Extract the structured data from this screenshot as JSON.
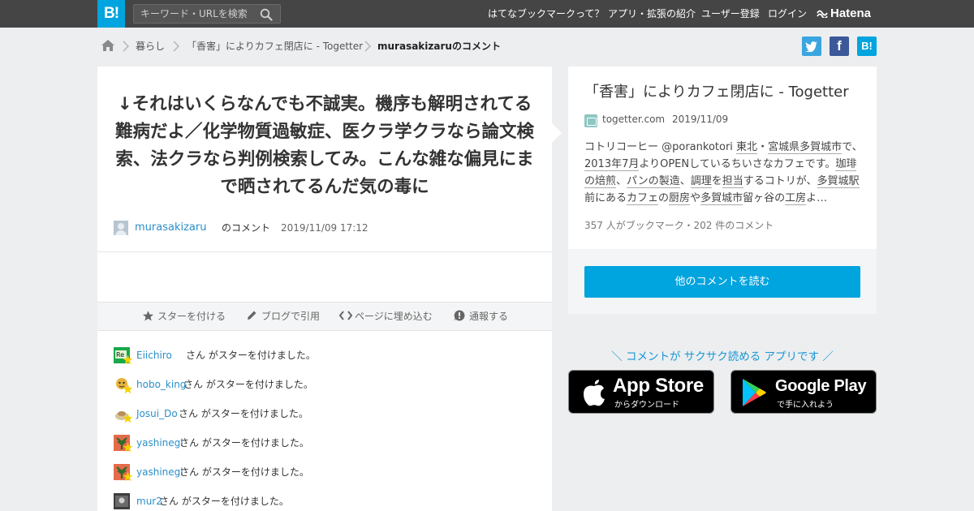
{
  "topbar": {
    "logo": "B!",
    "search_placeholder": "キーワード・URLを検索",
    "nav": [
      "はてなブックマークって？",
      "アプリ・拡張の紹介",
      "ユーザー登録",
      "ログイン"
    ],
    "brand": "Hatena"
  },
  "breadcrumb": {
    "items": [
      "暮らし",
      "「香害」によりカフェ閉店に - Togetter",
      "murasakizaruのコメント"
    ]
  },
  "share": {
    "twitter": "t",
    "facebook": "f",
    "hatebu": "B!"
  },
  "comment": {
    "text": "↓それはいくらなんでも不誠実。機序も解明されてる難病だよ／化学物質過敏症、医クラ学クラなら論文検索、法クラなら判例検索してみ。こんな雑な偏見にまで晒されてるんだ気の毒に",
    "user": "murasakizaru",
    "suffix": "のコメント",
    "timestamp": "2019/11/09 17:12"
  },
  "actions": [
    "スターを付ける",
    "ブログで引用",
    "ページに埋め込む",
    "通報する"
  ],
  "stars": {
    "suffix": "さん がスターを付けました。",
    "users": [
      "Eiichiro",
      "hobo_king",
      "Josui_Do",
      "yashinegi",
      "yashinegi",
      "mur2"
    ]
  },
  "entry": {
    "title": "「香害」によりカフェ閉店に - Togetter",
    "site": "togetter.com",
    "date": "2019/11/09",
    "summary": {
      "p1": "コトリコーヒー @porankotori ",
      "l1": "東北",
      "p2": "・",
      "l2": "宮城県",
      "l3": "多賀城市",
      "p3": "で、",
      "l4": "2013年",
      "l5": "7月",
      "p4": "よりOPENしているちいさなカフェです。",
      "l6": "珈琲",
      "l7": "の焙煎",
      "p5": "、",
      "l8": "パン",
      "l9": "の製造",
      "p6": "、",
      "l10": "調理",
      "p7": "を",
      "l11": "担当",
      "p8": "するコトリが、",
      "l12": "多賀城駅",
      "p9": "前にある",
      "l13": "カフェ",
      "p10": "の",
      "l14": "厨房",
      "p11": "や",
      "l15": "多賀城市",
      "p12": "留ヶ谷の",
      "l16": "工房",
      "p13": "よ…"
    },
    "counts": "357 人がブックマーク・202 件のコメント",
    "read_more": "他のコメントを読む"
  },
  "apps": {
    "promo": "＼ コメントが サクサク読める アプリです ／",
    "appstore_big": "App Store",
    "appstore_small": "からダウンロード",
    "googleplay_big": "Google Play",
    "googleplay_small": "で手に入れよう"
  },
  "colors": {
    "brand_blue": "#00a4de",
    "topbar": "#454545",
    "link": "#2a8fc8",
    "star": "#f5d100"
  }
}
